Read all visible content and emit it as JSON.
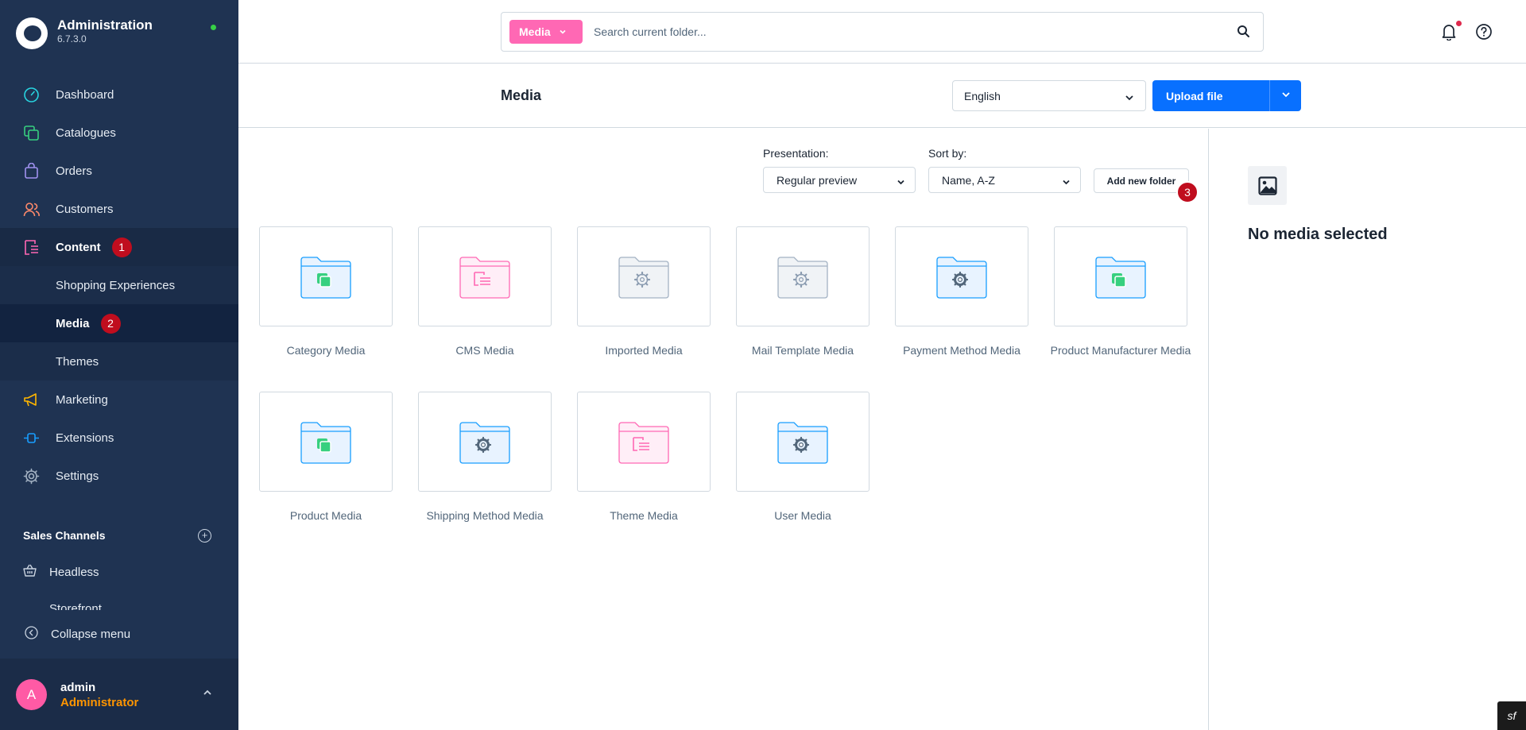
{
  "brand": {
    "title": "Administration",
    "version": "6.7.3.0"
  },
  "nav": {
    "items": [
      {
        "label": "Dashboard",
        "icon": "gauge-icon"
      },
      {
        "label": "Catalogues",
        "icon": "products-icon"
      },
      {
        "label": "Orders",
        "icon": "shopping-bag-icon"
      },
      {
        "label": "Customers",
        "icon": "users-icon"
      },
      {
        "label": "Content",
        "icon": "content-icon",
        "badge": "1"
      },
      {
        "label": "Marketing",
        "icon": "megaphone-icon"
      },
      {
        "label": "Extensions",
        "icon": "plug-icon"
      },
      {
        "label": "Settings",
        "icon": "gear-icon"
      }
    ],
    "content_sub": [
      {
        "label": "Shopping Experiences"
      },
      {
        "label": "Media",
        "badge": "2"
      },
      {
        "label": "Themes"
      }
    ]
  },
  "sales_channels": {
    "title": "Sales Channels",
    "items": [
      {
        "label": "Headless"
      },
      {
        "label": "Storefront"
      }
    ]
  },
  "collapse_label": "Collapse menu",
  "user": {
    "initial": "A",
    "name": "admin",
    "role": "Administrator"
  },
  "search": {
    "pill_label": "Media",
    "placeholder": "Search current folder..."
  },
  "header": {
    "title": "Media",
    "language": "English",
    "upload_label": "Upload file"
  },
  "toolbar": {
    "presentation_label": "Presentation:",
    "presentation_value": "Regular preview",
    "sort_label": "Sort by:",
    "sort_value": "Name, A-Z",
    "add_folder_label": "Add new folder",
    "add_folder_badge": "3"
  },
  "folders": [
    {
      "label": "Category Media",
      "icon": "folder-products-icon",
      "color": "#189eff"
    },
    {
      "label": "CMS Media",
      "icon": "folder-content-icon",
      "color": "#ff68b4"
    },
    {
      "label": "Imported Media",
      "icon": "folder-gear-icon",
      "color": "#a3b2c3"
    },
    {
      "label": "Mail Template Media",
      "icon": "folder-gear-icon",
      "color": "#a3b2c3"
    },
    {
      "label": "Payment Method Media",
      "icon": "folder-gear-icon",
      "color": "#189eff"
    },
    {
      "label": "Product Manufacturer Media",
      "icon": "folder-products-icon",
      "color": "#189eff"
    },
    {
      "label": "Product Media",
      "icon": "folder-products-icon",
      "color": "#189eff"
    },
    {
      "label": "Shipping Method Media",
      "icon": "folder-gear-icon",
      "color": "#189eff"
    },
    {
      "label": "Theme Media",
      "icon": "folder-content-icon",
      "color": "#ff68b4"
    },
    {
      "label": "User Media",
      "icon": "folder-gear-icon",
      "color": "#189eff"
    }
  ],
  "sidebar_right": {
    "empty_text": "No media selected"
  },
  "symfony_badge": "sf"
}
